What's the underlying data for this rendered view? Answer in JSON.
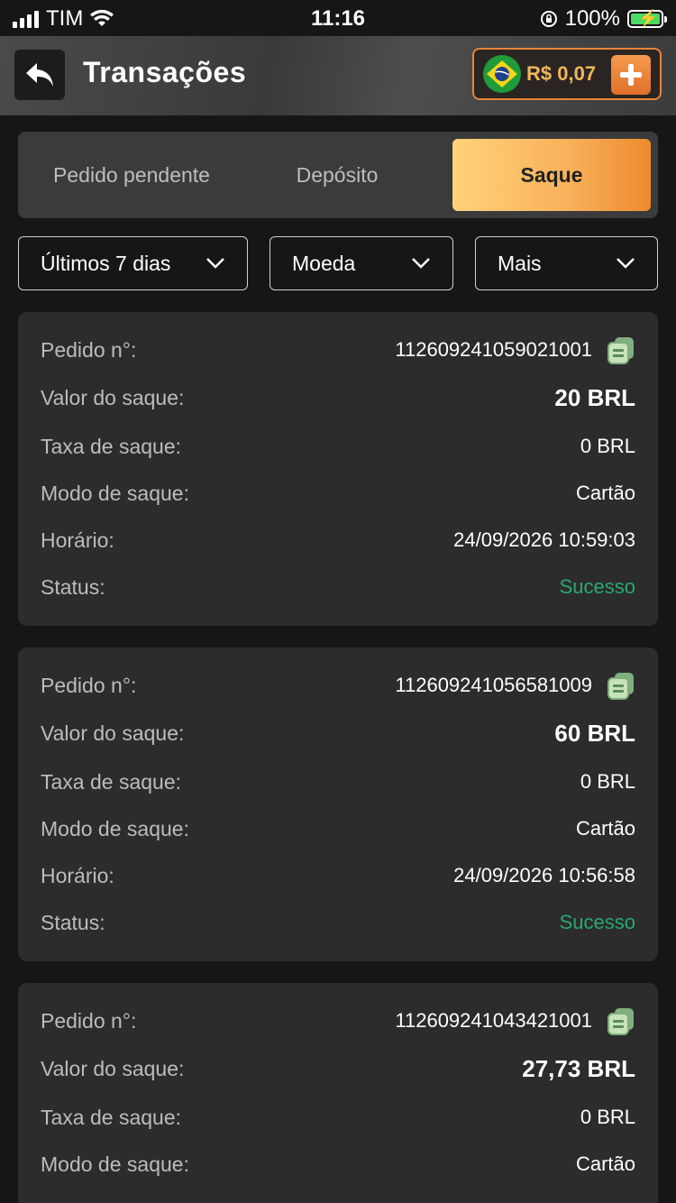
{
  "status_bar": {
    "carrier": "TIM",
    "time": "11:16",
    "battery": "100%"
  },
  "header": {
    "title": "Transações",
    "balance": "R$ 0,07",
    "back_icon": "back-arrow-icon",
    "plus_icon": "plus-icon",
    "flag_icon": "brazil-flag-icon"
  },
  "tabs": [
    {
      "label": "Pedido pendente",
      "active": false
    },
    {
      "label": "Depósito",
      "active": false
    },
    {
      "label": "Saque",
      "active": true
    }
  ],
  "filters": [
    {
      "label": "Últimos 7 dias"
    },
    {
      "label": "Moeda"
    },
    {
      "label": "Mais"
    }
  ],
  "labels": {
    "order": "Pedido n°:",
    "amount": "Valor do saque:",
    "fee": "Taxa de saque:",
    "mode": "Modo de saque:",
    "time": "Horário:",
    "status": "Status:"
  },
  "transactions": [
    {
      "order": "112609241059021001",
      "amount": "20 BRL",
      "fee": "0 BRL",
      "mode": "Cartão",
      "time": "24/09/2026 10:59:03",
      "status": "Sucesso"
    },
    {
      "order": "112609241056581009",
      "amount": "60 BRL",
      "fee": "0 BRL",
      "mode": "Cartão",
      "time": "24/09/2026 10:56:58",
      "status": "Sucesso"
    },
    {
      "order": "112609241043421001",
      "amount": "27,73 BRL",
      "fee": "0 BRL",
      "mode": "Cartão"
    }
  ],
  "colors": {
    "accent": "#ef8a2e",
    "success": "#2aa872",
    "card": "#2c2c2c"
  }
}
